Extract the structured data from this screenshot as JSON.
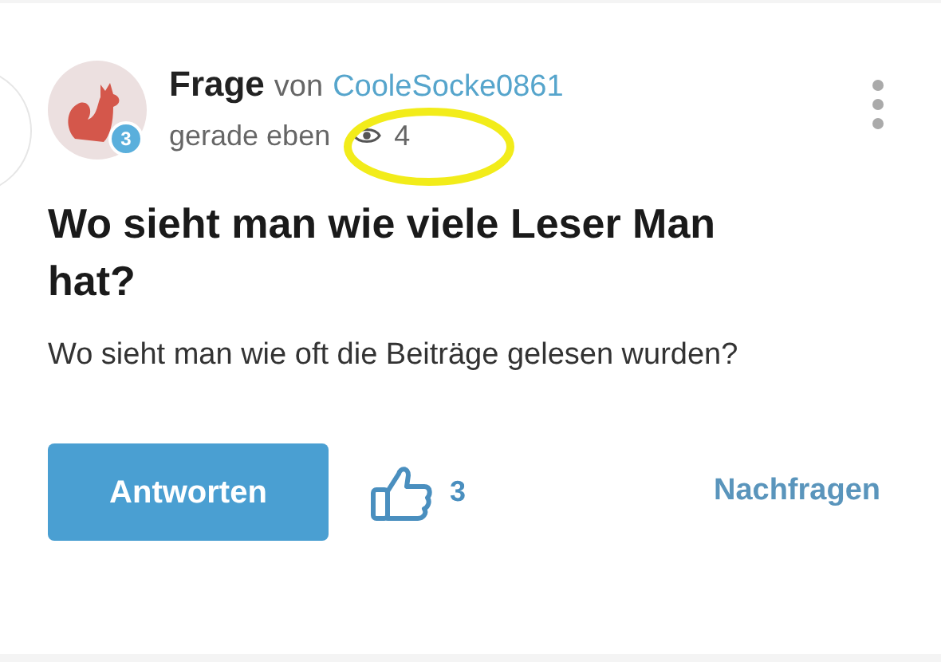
{
  "post": {
    "type_label": "Frage",
    "by": "von",
    "author": "CooleSocke0861",
    "level": "3",
    "time": "gerade eben",
    "views": "4",
    "title": "Wo sieht man wie viele Leser Man hat?",
    "body": "Wo sieht man wie oft die Beiträge gelesen wurden?"
  },
  "actions": {
    "answer": "Antworten",
    "likes": "3",
    "follow_up": "Nachfragen"
  }
}
